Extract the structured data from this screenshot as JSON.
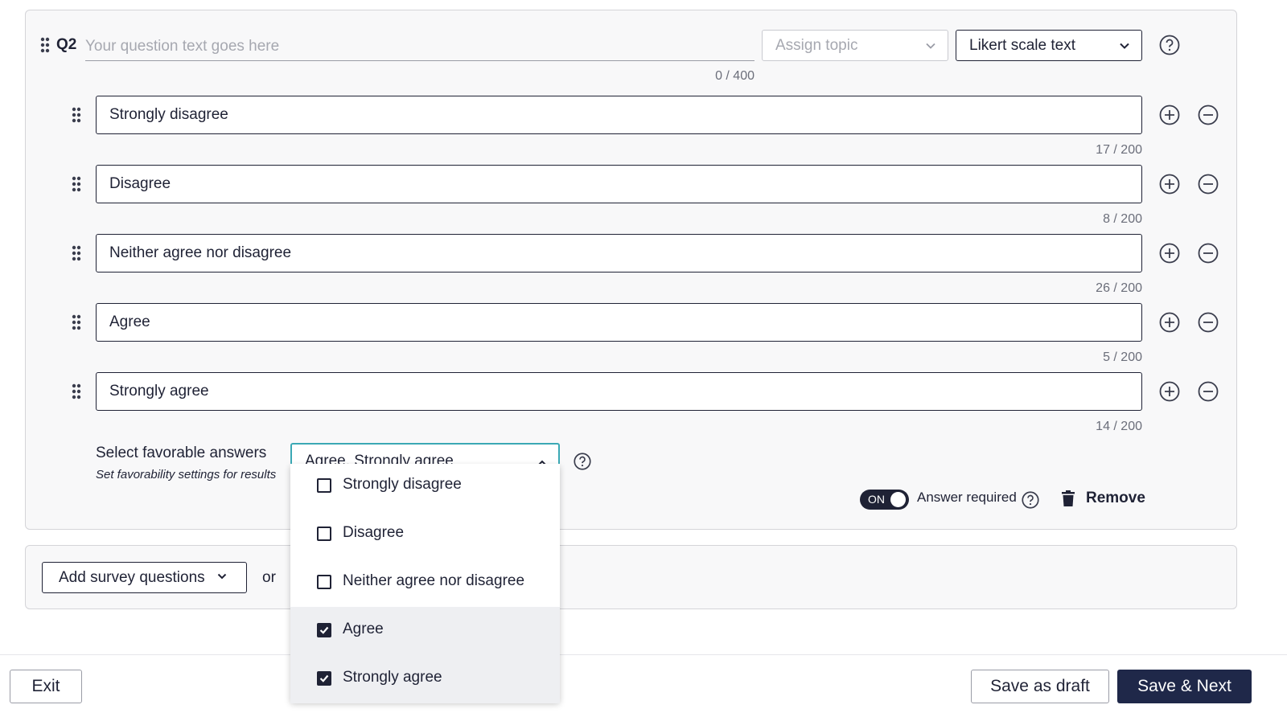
{
  "question": {
    "number": "Q2",
    "placeholder": "Your question text goes here",
    "value": "",
    "char_count": "0 / 400",
    "topic_placeholder": "Assign topic",
    "type_value": "Likert scale text"
  },
  "answers": [
    {
      "value": "Strongly disagree",
      "count": "17 / 200"
    },
    {
      "value": "Disagree",
      "count": "8 / 200"
    },
    {
      "value": "Neither agree nor disagree",
      "count": "26 / 200"
    },
    {
      "value": "Agree",
      "count": "5 / 200"
    },
    {
      "value": "Strongly agree",
      "count": "14 / 200"
    }
  ],
  "favorable": {
    "label": "Select favorable answers",
    "sublabel": "Set favorability settings for results",
    "selected_text": "Agree, Strongly agree",
    "options": [
      {
        "label": "Strongly disagree",
        "checked": false
      },
      {
        "label": "Disagree",
        "checked": false
      },
      {
        "label": "Neither agree nor disagree",
        "checked": false
      },
      {
        "label": "Agree",
        "checked": true
      },
      {
        "label": "Strongly agree",
        "checked": true
      }
    ]
  },
  "required": {
    "toggle_text": "ON",
    "label": "Answer required"
  },
  "remove_label": "Remove",
  "add_section": {
    "add_button": "Add survey questions",
    "or_text": "or"
  },
  "footer": {
    "exit": "Exit",
    "save_draft": "Save as draft",
    "save_next": "Save & Next"
  },
  "icons": {
    "drag": "drag-handle-icon",
    "help": "help-circle-icon",
    "add": "plus-circle-icon",
    "remove": "minus-circle-icon",
    "trash": "trash-icon",
    "chevron": "chevron-down-icon"
  },
  "colors": {
    "primary": "#1f2849",
    "text": "#1f2235",
    "focus": "#3ba9b5",
    "card_bg": "#f8f8f9"
  }
}
